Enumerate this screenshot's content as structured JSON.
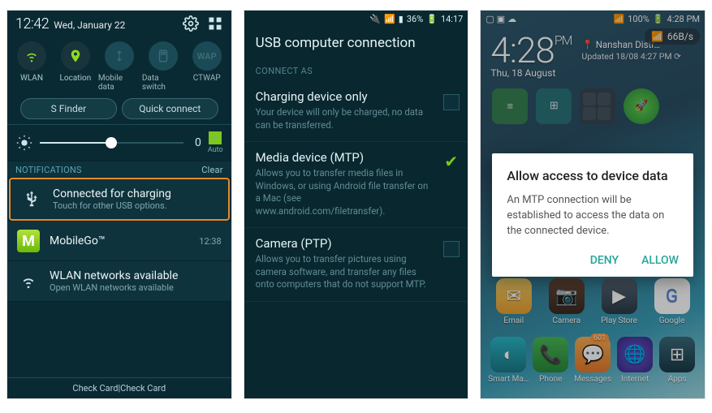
{
  "screen1": {
    "time": "12:42",
    "date": "Wed, January 22",
    "toggles": [
      {
        "label": "WLAN",
        "icon": "wifi",
        "on": true
      },
      {
        "label": "Location",
        "icon": "location",
        "on": true
      },
      {
        "label": "Mobile data",
        "icon": "data",
        "on": false
      },
      {
        "label": "Data switch",
        "icon": "switch",
        "on": false
      },
      {
        "label": "CTWAP",
        "icon": "wap",
        "text": "WAP",
        "on": false
      }
    ],
    "sfinder": "S Finder",
    "quickconnect": "Quick connect",
    "brightness_value": "0",
    "auto_label": "Auto",
    "section_header": "NOTIFICATIONS",
    "clear": "Clear",
    "notifications": [
      {
        "title": "Connected for charging",
        "sub": "Touch for other USB options.",
        "highlight": true,
        "icon": "usb"
      },
      {
        "title": "MobileGo™",
        "time": "12:38",
        "icon": "mobilego"
      },
      {
        "title": "WLAN networks available",
        "sub": "Open WLAN networks available",
        "icon": "wifi-open"
      }
    ],
    "footer": "Check Card|Check Card"
  },
  "screen2": {
    "status": {
      "battery": "36%",
      "time": "14:17"
    },
    "title": "USB computer connection",
    "section": "CONNECT AS",
    "options": [
      {
        "title": "Charging device only",
        "desc": "Your device will only be charged, no data can be transferred.",
        "checked": false
      },
      {
        "title": "Media device (MTP)",
        "desc": "Allows you to transfer media files in Windows, or using Android file transfer on a Mac (see www.android.com/filetransfer).",
        "checked": true
      },
      {
        "title": "Camera (PTP)",
        "desc": "Allows you to transfer pictures using camera software, and transfer any files onto computers that do not support MTP.",
        "checked": false
      }
    ]
  },
  "screen3": {
    "status": {
      "battery": "100%",
      "time": "4:28 PM"
    },
    "net_speed": "66B/s",
    "clock": {
      "time": "4:28",
      "ampm": "PM",
      "date": "Thu, 18 August"
    },
    "location_line1": "Nanshan Distr…",
    "location_line2": "Updated 18/08 4:27 PM",
    "dialog": {
      "title": "Allow access to device data",
      "message": "An MTP connection will be established to access the data on the connected device.",
      "deny": "DENY",
      "allow": "ALLOW"
    },
    "row_icons": [
      {
        "label": "Email"
      },
      {
        "label": "Camera"
      },
      {
        "label": "Play Store"
      },
      {
        "label": "Google"
      }
    ],
    "dock_icons": [
      {
        "label": "Smart Ma…"
      },
      {
        "label": "Phone"
      },
      {
        "label": "Messages",
        "badge": "601"
      },
      {
        "label": "Internet"
      },
      {
        "label": "Apps"
      }
    ]
  }
}
